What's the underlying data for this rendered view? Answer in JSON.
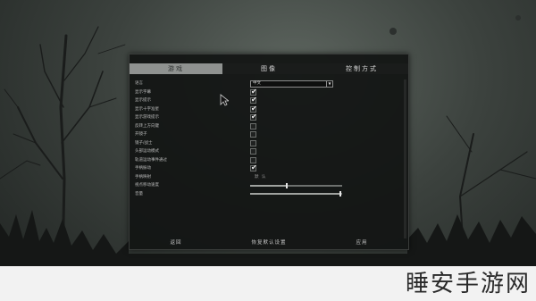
{
  "tabs": [
    {
      "label": "游戏",
      "active": true
    },
    {
      "label": "图像",
      "active": false
    },
    {
      "label": "控制方式",
      "active": false
    }
  ],
  "settings": [
    {
      "label": "语言",
      "control": "select",
      "value": "中文"
    },
    {
      "label": "显示字幕",
      "control": "checkbox",
      "checked": true
    },
    {
      "label": "显示提示",
      "control": "checkbox",
      "checked": true
    },
    {
      "label": "显示十字准星",
      "control": "checkbox",
      "checked": true
    },
    {
      "label": "显示游戏提示",
      "control": "checkbox",
      "checked": true
    },
    {
      "label": "反转上方向键",
      "control": "checkbox",
      "checked": false
    },
    {
      "label": "开镜子",
      "control": "checkbox",
      "checked": false
    },
    {
      "label": "镜子/战士",
      "control": "checkbox",
      "checked": false
    },
    {
      "label": "头部运动模式",
      "control": "checkbox",
      "checked": false
    },
    {
      "label": "轨道运动事件通过",
      "control": "checkbox",
      "checked": false
    },
    {
      "label": "手柄振动",
      "control": "checkbox",
      "checked": true
    },
    {
      "label": "手柄映射",
      "control": "text",
      "value": "默 认"
    },
    {
      "label": "视点移动速度",
      "control": "slider",
      "value": 0.4
    },
    {
      "label": "音量",
      "control": "slider",
      "value": 0.98
    }
  ],
  "footer": {
    "back_label": "返回",
    "reset_label": "恢复默认设置",
    "apply_label": "应用"
  },
  "watermark": "睡安手游网",
  "colors": {
    "panel_bg": "#121413",
    "active_tab": "#8f9290",
    "background": "#3c423e"
  }
}
